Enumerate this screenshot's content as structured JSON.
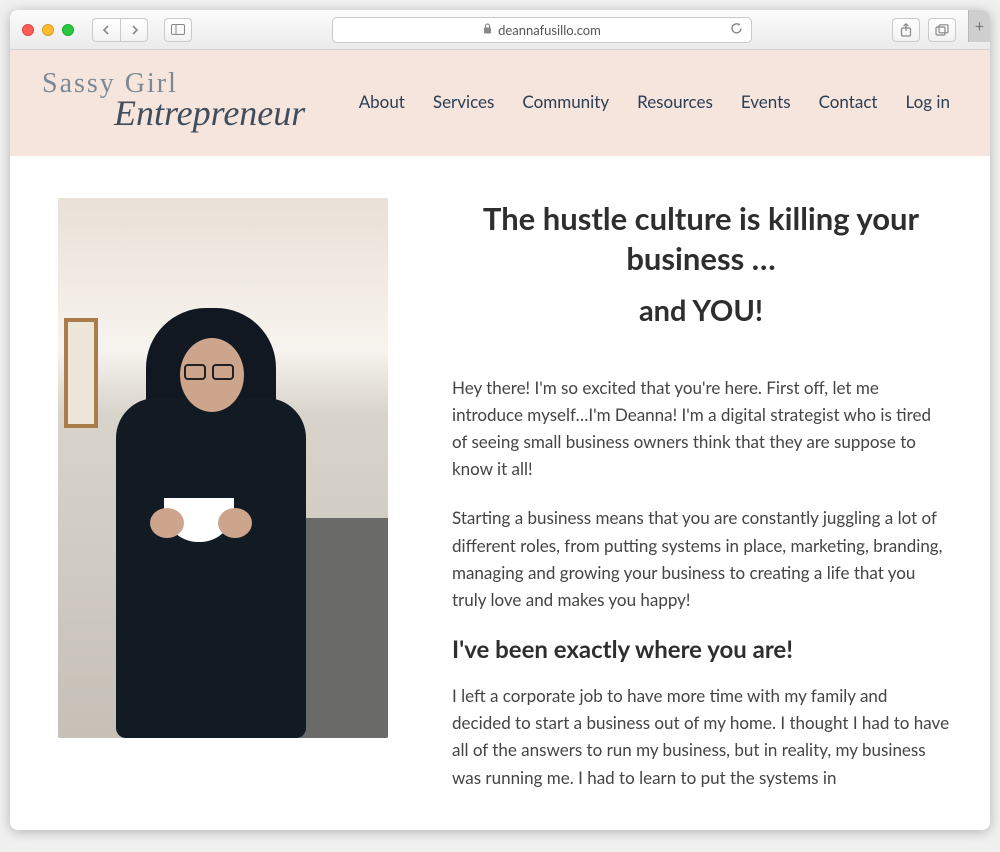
{
  "browser": {
    "url_display": "deannafusillo.com"
  },
  "logo": {
    "line1": "Sassy Girl",
    "line2": "Entrepreneur"
  },
  "nav": {
    "items": [
      {
        "label": "About"
      },
      {
        "label": "Services"
      },
      {
        "label": "Community"
      },
      {
        "label": "Resources"
      },
      {
        "label": "Events"
      },
      {
        "label": "Contact"
      },
      {
        "label": "Log in"
      }
    ]
  },
  "article": {
    "headline_a": "The hustle culture is killing your business …",
    "headline_b": "and YOU!",
    "p1": "Hey there! I'm so excited that you're here. First off, let me introduce myself…I'm Deanna! I'm a digital strategist who is tired of seeing small business owners think that they are suppose to know it all!",
    "p2": "Starting a business means that you are constantly juggling a lot of different roles, from putting systems in place, marketing, branding, managing and growing your business to creating a life that you truly love and makes you happy!",
    "subhead": "I've been exactly where you are!",
    "p3": "I left a corporate job to have more time with my family and decided to start a business out of my home. I thought I had to have all of the answers to run my business, but in reality, my business was running me. I had to learn to put the systems in"
  }
}
